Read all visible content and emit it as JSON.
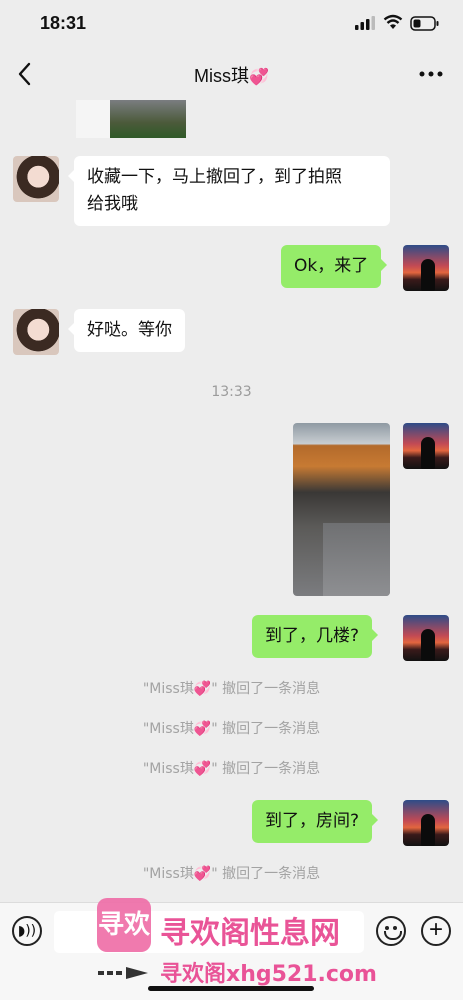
{
  "status_bar": {
    "time": "18:31"
  },
  "nav": {
    "title": "Miss琪",
    "title_emoji": "💞"
  },
  "messages": [
    {
      "side": "left",
      "text_line1": "收藏一下，马上撤回了，到了拍照",
      "text_line2": "给我哦"
    },
    {
      "side": "right",
      "text": "Ok，来了"
    },
    {
      "side": "left",
      "text": "好哒。等你"
    },
    {
      "side": "right",
      "text": "到了，几楼?"
    },
    {
      "side": "right",
      "text": "到了，房间?"
    }
  ],
  "timestamp": "13:33",
  "recall": {
    "prefix": "\"Miss琪",
    "emoji": "💞",
    "suffix": "\" 撤回了一条消息"
  },
  "watermark": {
    "logo_text": "寻欢",
    "text": "寻欢阁性息网",
    "url": "寻欢阁xhg521.com"
  }
}
